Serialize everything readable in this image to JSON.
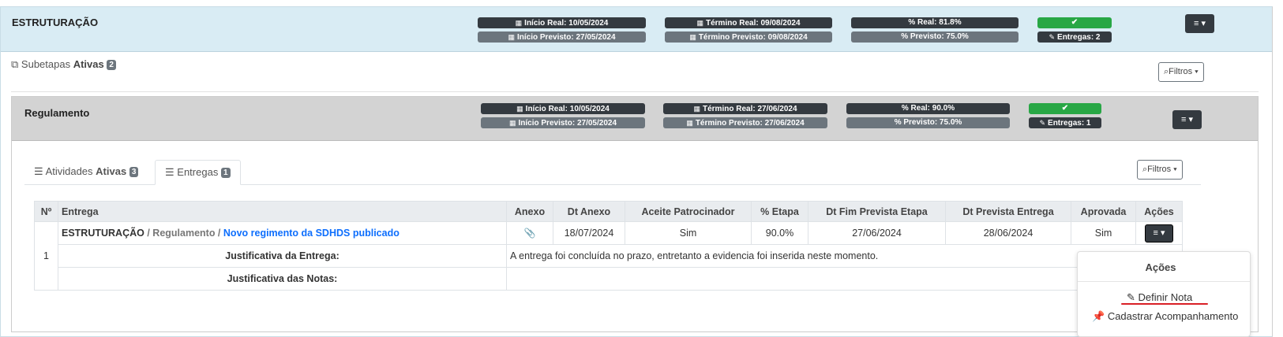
{
  "stage": {
    "title": "ESTRUTURAÇÃO",
    "inicio_real": "Início Real: 10/05/2024",
    "inicio_previsto": "Início Previsto: 27/05/2024",
    "termino_real": "Término Real: 09/08/2024",
    "termino_previsto": "Término Previsto: 09/08/2024",
    "pct_real": "% Real: 81.8%",
    "pct_previsto": "% Previsto: 75.0%",
    "entregas": "Entregas: 2",
    "menu_label": "≡ ▾"
  },
  "subetapas": {
    "label_prefix": "Subetapas",
    "label_bold": "Ativas",
    "count": "2",
    "filter_label": "Filtros"
  },
  "substage": {
    "title": "Regulamento",
    "inicio_real": "Início Real: 10/05/2024",
    "inicio_previsto": "Início Previsto: 27/05/2024",
    "termino_real": "Término Real: 27/06/2024",
    "termino_previsto": "Término Previsto: 27/06/2024",
    "pct_real": "% Real: 90.0%",
    "pct_previsto": "% Previsto: 75.0%",
    "entregas": "Entregas: 1",
    "menu_label": "≡ ▾",
    "filter_label": "Filtros"
  },
  "tabs": [
    {
      "label": "Atividades",
      "bold": "Ativas",
      "count": "3"
    },
    {
      "label": "Entregas",
      "bold": "",
      "count": "1"
    }
  ],
  "table": {
    "headers": [
      "Nº",
      "Entrega",
      "Anexo",
      "Dt Anexo",
      "Aceite Patrocinador",
      "% Etapa",
      "Dt Fim Prevista Etapa",
      "Dt Prevista Entrega",
      "Aprovada",
      "Ações"
    ],
    "row": {
      "num": "1",
      "crumb_stage": "ESTRUTURAÇÃO",
      "crumb_sub": "/ Regulamento /",
      "crumb_link": "Novo regimento da SDHDS publicado",
      "dt_anexo": "18/07/2024",
      "aceite": "Sim",
      "pct_etapa": "90.0%",
      "dt_fim_prevista": "27/06/2024",
      "dt_prevista_entrega": "28/06/2024",
      "aprovada": "Sim"
    },
    "just_entrega_label": "Justificativa da Entrega:",
    "just_entrega_text": "A entrega foi concluída no prazo, entretanto a evidencia foi inserida neste momento.",
    "just_notas_label": "Justificativa das Notas:",
    "just_notas_text": ""
  },
  "dropdown": {
    "header": "Ações",
    "items": [
      "Definir Nota",
      "Cadastrar Acompanhamento"
    ]
  },
  "colors": {
    "stage_header_bg": "#d9ecf4",
    "substage_header_bg": "#d3d3d3",
    "pill_dark": "#343a40",
    "pill_gray": "#6c757d",
    "pill_green": "#28a745",
    "link_blue": "#0d6efd",
    "highlight_red": "#d91f26"
  }
}
